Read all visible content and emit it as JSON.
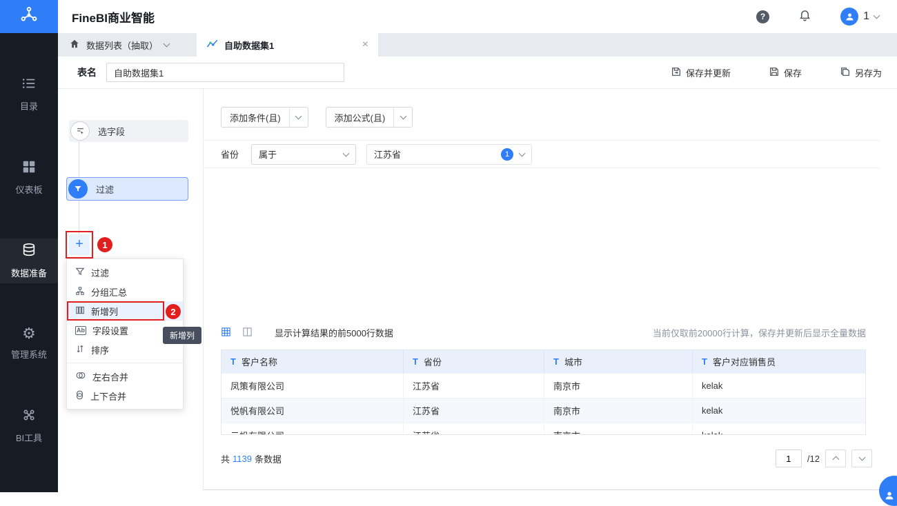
{
  "colors": {
    "accent": "#2f7ef7",
    "annotation_red": "#e21f1f",
    "sidebar_bg": "#171b24"
  },
  "app": {
    "title": "FineBI商业智能",
    "user_label": "1"
  },
  "sidebar": {
    "items": [
      {
        "label": "目录",
        "icon": "list-icon",
        "active": false
      },
      {
        "label": "仪表板",
        "icon": "dashboard-icon",
        "active": false
      },
      {
        "label": "数据准备",
        "icon": "database-icon",
        "active": true
      },
      {
        "label": "管理系统",
        "icon": "gear-icon",
        "active": false
      },
      {
        "label": "BI工具",
        "icon": "tools-icon",
        "active": false
      }
    ]
  },
  "tabbar": {
    "home_tab": {
      "label": "数据列表（抽取）",
      "icon": "home-icon"
    },
    "active_tab": {
      "label": "自助数据集1",
      "icon": "dataset-icon",
      "close": "×"
    }
  },
  "namebar": {
    "label": "表名",
    "value": "自助数据集1",
    "actions": [
      {
        "label": "保存并更新",
        "icon": "save-update-icon"
      },
      {
        "label": "保存",
        "icon": "save-icon"
      },
      {
        "label": "另存为",
        "icon": "save-as-icon"
      }
    ]
  },
  "steps": {
    "select_field": "选字段",
    "filter": "过滤",
    "add_plus": "+"
  },
  "menu": {
    "items": [
      {
        "label": "过滤",
        "icon": "filter-icon"
      },
      {
        "label": "分组汇总",
        "icon": "group-summary-icon"
      },
      {
        "label": "新增列",
        "icon": "add-column-icon",
        "highlighted": true
      },
      {
        "label": "字段设置",
        "icon": "field-settings-icon",
        "glyph": "Ab"
      },
      {
        "label": "排序",
        "icon": "sort-icon"
      },
      {
        "label": "左右合并",
        "icon": "merge-left-right-icon"
      },
      {
        "label": "上下合并",
        "icon": "merge-top-bottom-icon"
      }
    ],
    "tooltip": "新增列"
  },
  "annotations": {
    "badge1": "1",
    "badge2": "2"
  },
  "filters": {
    "add_condition": "添加条件(且)",
    "add_formula": "添加公式(且)",
    "condition": {
      "field": "省份",
      "operator": "属于",
      "value": "江苏省",
      "count": "1"
    }
  },
  "preview": {
    "info": "显示计算结果的前5000行数据",
    "notice": "当前仅取前20000行计算，保存并更新后显示全量数据",
    "table": {
      "type_icon": "T",
      "columns": [
        "客户名称",
        "省份",
        "城市",
        "客户对应销售员"
      ],
      "rows": [
        [
          "凤策有限公司",
          "江苏省",
          "南京市",
          "kelak"
        ],
        [
          "悦帆有限公司",
          "江苏省",
          "南京市",
          "kelak"
        ],
        [
          "云帆有限公司",
          "江苏省",
          "南京市",
          "kelak"
        ]
      ]
    },
    "footer": {
      "total_prefix": "共",
      "total_count": "1139",
      "total_suffix": "条数据",
      "page_value": "1",
      "page_total": "/12"
    }
  }
}
